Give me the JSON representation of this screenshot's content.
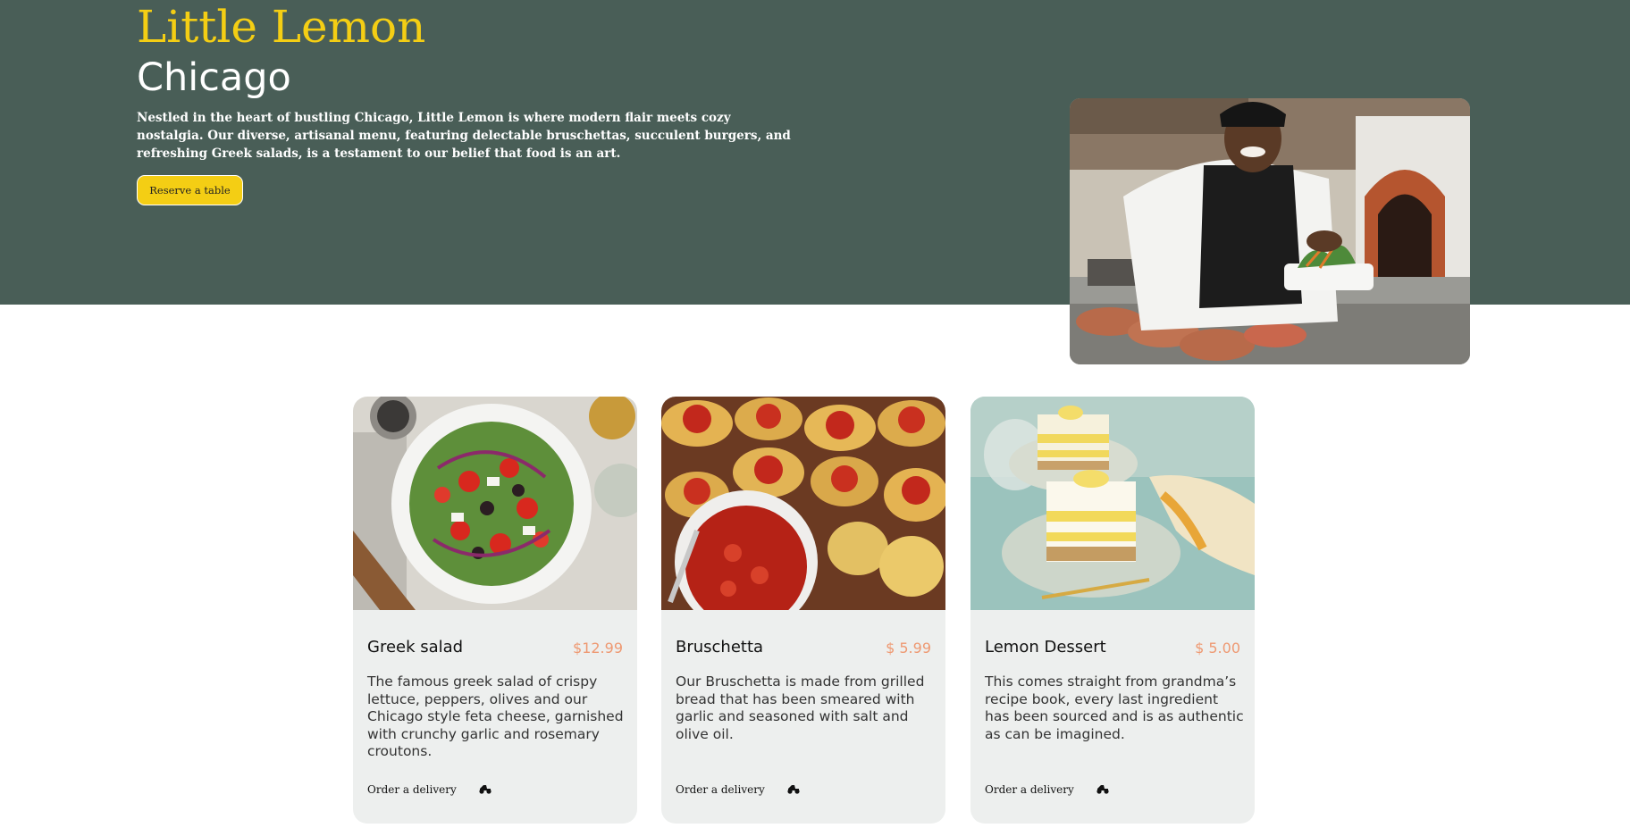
{
  "hero": {
    "title": "Little Lemon",
    "subtitle": "Chicago",
    "description": "Nestled in the heart of bustling Chicago, Little Lemon is where modern flair meets cozy nostalgia. Our diverse, artisanal menu, featuring delectable bruschettas, succulent burgers, and refreshing Greek salads, is a testament to our belief that food is an art.",
    "reserve_label": "Reserve a table"
  },
  "specials": [
    {
      "title": "Greek salad",
      "price": "$12.99",
      "description": "The famous greek salad of crispy lettuce, peppers, olives and our Chicago style feta cheese, garnished with crunchy garlic and rosemary croutons.",
      "order_label": "Order a delivery"
    },
    {
      "title": "Bruschetta",
      "price": "$ 5.99",
      "description": "Our Bruschetta is made from grilled bread that has been smeared with garlic and seasoned with salt and olive oil.",
      "order_label": "Order a delivery"
    },
    {
      "title": "Lemon Dessert",
      "price": "$ 5.00",
      "description": "This comes straight from grandma’s recipe book, every last ingredient has been sourced and is as authentic as can be imagined.",
      "order_label": "Order a delivery"
    }
  ],
  "icons": {
    "hero_image": "chef-photo",
    "card_images": [
      "greek-salad-photo",
      "bruschetta-photo",
      "lemon-dessert-photo"
    ],
    "delivery": "delivery-scooter-icon"
  },
  "colors": {
    "primary_green": "#495e57",
    "primary_yellow": "#f4ce14",
    "price_orange": "#ee9972",
    "card_background": "#edefee"
  }
}
